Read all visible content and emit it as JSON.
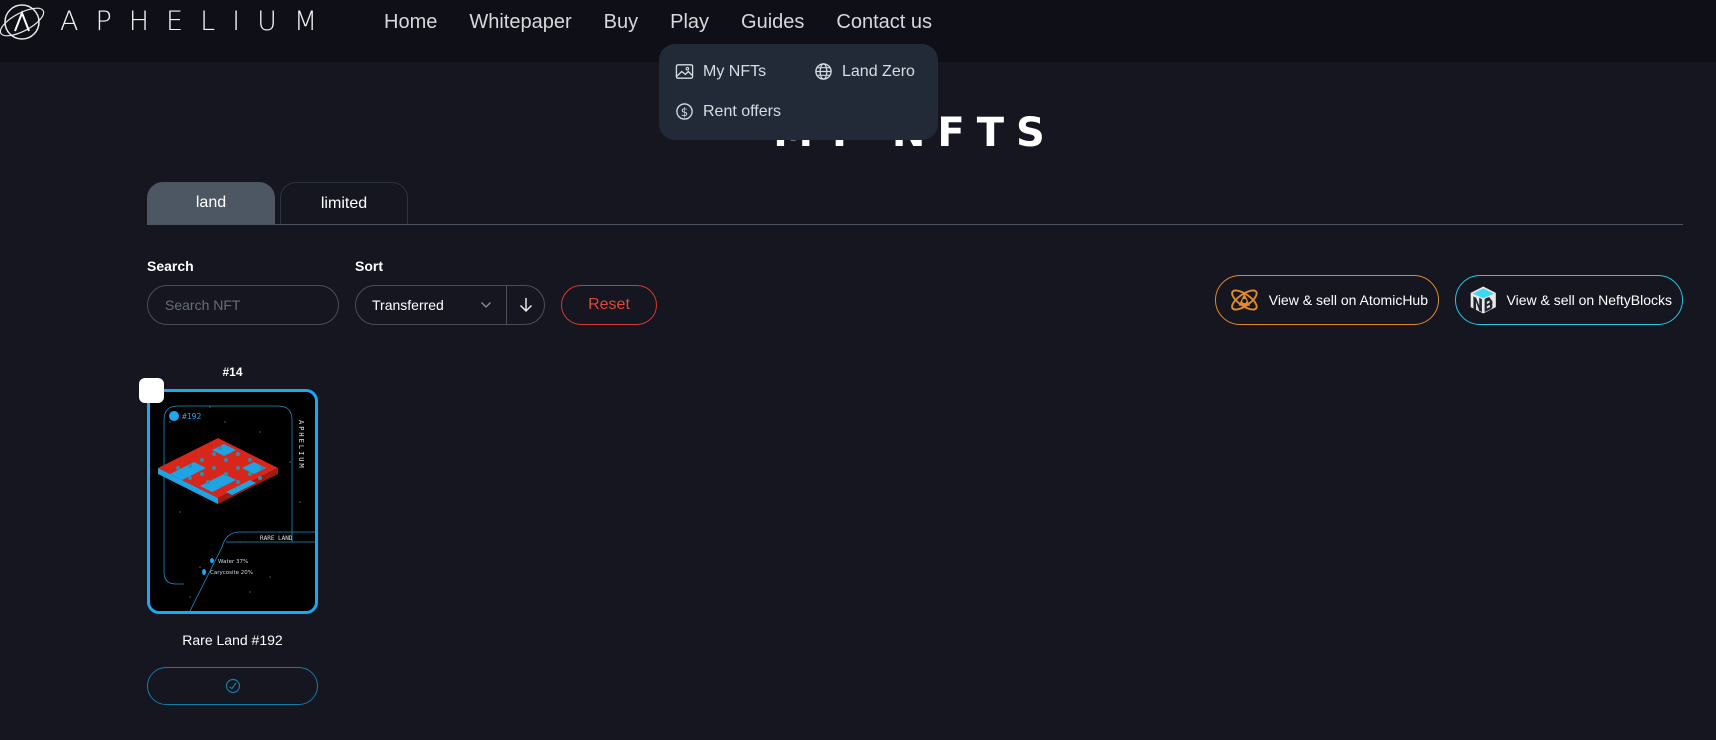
{
  "header": {
    "logo_text": "APHELIUM",
    "nav": [
      "Home",
      "Whitepaper",
      "Buy",
      "Play",
      "Guides",
      "Contact us"
    ]
  },
  "play_dropdown": {
    "items": [
      {
        "label": "My NFTs",
        "icon": "image-icon"
      },
      {
        "label": "Land Zero",
        "icon": "globe-icon"
      },
      {
        "label": "Rent offers",
        "icon": "dollar-circle-icon"
      }
    ]
  },
  "page": {
    "title": "MY NFTS",
    "tabs": [
      {
        "label": "land",
        "active": true
      },
      {
        "label": "limited",
        "active": false
      }
    ]
  },
  "filters": {
    "search_label": "Search",
    "search_placeholder": "Search NFT",
    "search_value": "",
    "sort_label": "Sort",
    "sort_value": "Transferred",
    "sort_direction": "descending",
    "reset_label": "Reset"
  },
  "marketplaces": {
    "atomichub_label": "View & sell on AtomicHub",
    "neftyblocks_label": "View & sell on NeftyBlocks"
  },
  "colors": {
    "accent_blue": "#1da7ee",
    "reset_red": "#e0443a",
    "atomic_orange": "#e08a2c",
    "nefty_cyan": "#27c6e4",
    "land_red": "#d8261a"
  },
  "nfts": [
    {
      "index": "#14",
      "name": "Rare Land #192",
      "card_id": "#192",
      "card_brand": "APHELIUM",
      "rarity": "RARE LAND",
      "stats": [
        "Water 37%",
        "Carycosite 20%"
      ],
      "selected": false
    }
  ]
}
